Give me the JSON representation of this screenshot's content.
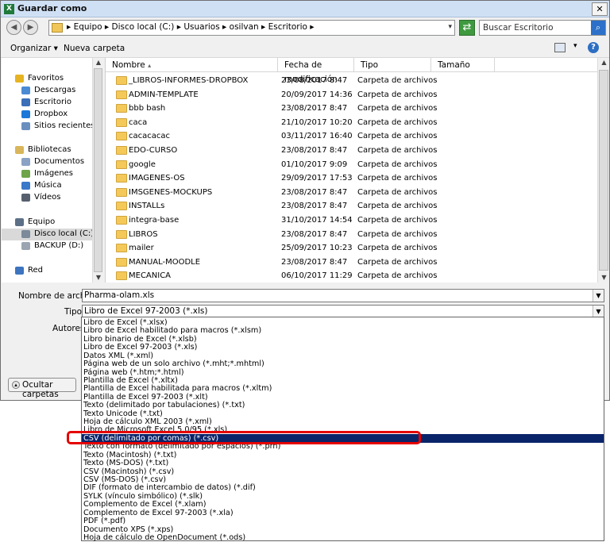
{
  "window": {
    "title": "Guardar como",
    "icon_label": "X",
    "close": "✕"
  },
  "nav": {
    "back": "◀",
    "forward": "▶",
    "dropdown": "▾",
    "refresh": "⇄",
    "breadcrumb": "▸  Equipo  ▸  Disco local (C:)  ▸  Usuarios  ▸  osilvan  ▸  Escritorio  ▸",
    "search_placeholder": "Buscar Escritorio",
    "search_glyph": "⌕"
  },
  "toolbar": {
    "organize": "Organizar  ▾",
    "new_folder": "Nueva carpeta",
    "view_dd": "▾",
    "help": "?"
  },
  "sidebar": [
    {
      "label": "Favoritos",
      "color": "#e6b422"
    },
    {
      "label": "Descargas",
      "color": "#4a8ad4"
    },
    {
      "label": "Escritorio",
      "color": "#3b6fb8"
    },
    {
      "label": "Dropbox",
      "color": "#1d77d8"
    },
    {
      "label": "Sitios recientes",
      "color": "#6a8fbf"
    },
    {
      "label": "Bibliotecas",
      "color": "#d9b65a"
    },
    {
      "label": "Documentos",
      "color": "#8aa2c4"
    },
    {
      "label": "Imágenes",
      "color": "#6fa44a"
    },
    {
      "label": "Música",
      "color": "#3a78c9"
    },
    {
      "label": "Vídeos",
      "color": "#555f6e"
    },
    {
      "label": "Equipo",
      "color": "#5c6f86"
    },
    {
      "label": "Disco local (C:)",
      "color": "#7c8a99"
    },
    {
      "label": "BACKUP (D:)",
      "color": "#9aa5b1"
    },
    {
      "label": "Red",
      "color": "#3d74bf"
    }
  ],
  "columns": {
    "name": "Nombre",
    "date": "Fecha de modificación",
    "type": "Tipo",
    "size": "Tamaño",
    "sort": "▴"
  },
  "files": [
    {
      "name": "_LIBROS-INFORMES-DROPBOX",
      "date": "23/08/2017 8:47",
      "type": "Carpeta de archivos"
    },
    {
      "name": "ADMIN-TEMPLATE",
      "date": "20/09/2017 14:36",
      "type": "Carpeta de archivos"
    },
    {
      "name": "bbb bash",
      "date": "23/08/2017 8:47",
      "type": "Carpeta de archivos"
    },
    {
      "name": "caca",
      "date": "21/10/2017 10:20",
      "type": "Carpeta de archivos"
    },
    {
      "name": "cacacacac",
      "date": "03/11/2017 16:40",
      "type": "Carpeta de archivos"
    },
    {
      "name": "EDO-CURSO",
      "date": "23/08/2017 8:47",
      "type": "Carpeta de archivos"
    },
    {
      "name": "google",
      "date": "01/10/2017 9:09",
      "type": "Carpeta de archivos"
    },
    {
      "name": "IMAGENES-OS",
      "date": "29/09/2017 17:53",
      "type": "Carpeta de archivos"
    },
    {
      "name": "IMSGENES-MOCKUPS",
      "date": "23/08/2017 8:47",
      "type": "Carpeta de archivos"
    },
    {
      "name": "INSTALLs",
      "date": "23/08/2017 8:47",
      "type": "Carpeta de archivos"
    },
    {
      "name": "integra-base",
      "date": "31/10/2017 14:54",
      "type": "Carpeta de archivos"
    },
    {
      "name": "LIBROS",
      "date": "23/08/2017 8:47",
      "type": "Carpeta de archivos"
    },
    {
      "name": "mailer",
      "date": "25/09/2017 10:23",
      "type": "Carpeta de archivos"
    },
    {
      "name": "MANUAL-MOODLE",
      "date": "23/08/2017 8:47",
      "type": "Carpeta de archivos"
    },
    {
      "name": "MECANICA",
      "date": "06/10/2017 11:29",
      "type": "Carpeta de archivos"
    }
  ],
  "scroll": {
    "up": "▲",
    "down": "▼"
  },
  "form": {
    "filename_label": "Nombre de archivo:",
    "filename_value": "Pharma-olam.xls",
    "type_label": "Tipo:",
    "type_value": "Libro de Excel 97-2003 (*.xls)",
    "authors_label": "Autores:",
    "dd_glyph": "▼"
  },
  "hide_folders": {
    "label": "Ocultar carpetas",
    "glyph": "▴"
  },
  "type_options": [
    "Libro de Excel (*.xlsx)",
    "Libro de Excel habilitado para macros (*.xlsm)",
    "Libro binario de Excel (*.xlsb)",
    "Libro de Excel 97-2003 (*.xls)",
    "Datos XML (*.xml)",
    "Página web de un solo archivo (*.mht;*.mhtml)",
    "Página web (*.htm;*.html)",
    "Plantilla de Excel (*.xltx)",
    "Plantilla de Excel habilitada para macros (*.xltm)",
    "Plantilla de Excel 97-2003 (*.xlt)",
    "Texto (delimitado por tabulaciones) (*.txt)",
    "Texto Unicode (*.txt)",
    "Hoja de cálculo XML 2003 (*.xml)",
    "Libro de Microsoft Excel 5.0/95 (*.xls)",
    "CSV (delimitado por comas) (*.csv)",
    "Texto con formato (delimitado por espacios) (*.prn)",
    "Texto (Macintosh) (*.txt)",
    "Texto (MS-DOS) (*.txt)",
    "CSV (Macintosh) (*.csv)",
    "CSV (MS-DOS) (*.csv)",
    "DIF (formato de intercambio de datos) (*.dif)",
    "SYLK (vínculo simbólico) (*.slk)",
    "Complemento de Excel (*.xlam)",
    "Complemento de Excel 97-2003 (*.xla)",
    "PDF (*.pdf)",
    "Documento XPS (*.xps)",
    "Hoja de cálculo de OpenDocument (*.ods)"
  ],
  "selected_type_index": 14
}
